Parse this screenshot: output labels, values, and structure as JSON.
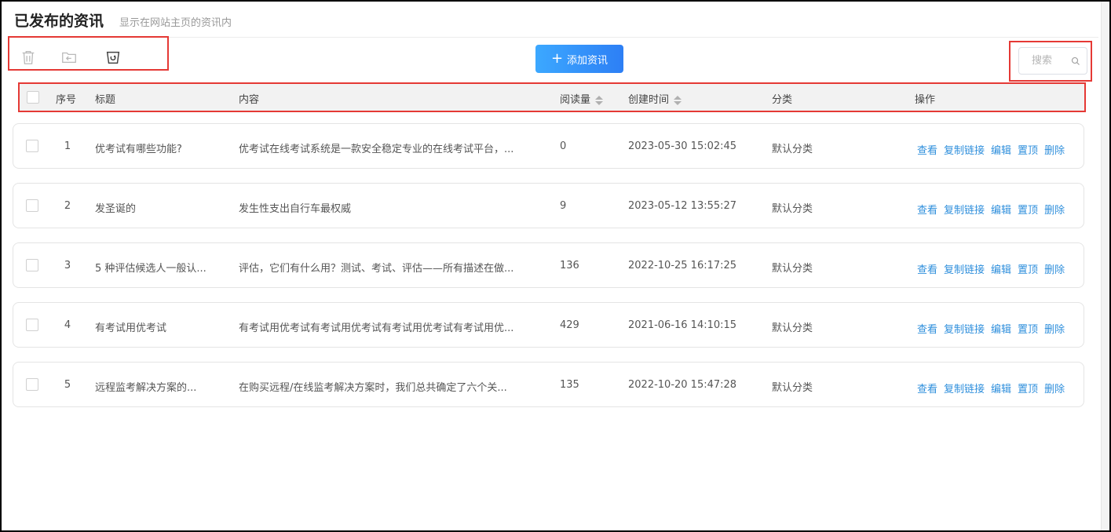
{
  "header": {
    "title": "已发布的资讯",
    "subtitle": "显示在网站主页的资讯内"
  },
  "toolbar": {
    "icons": [
      "trash-icon",
      "folder-back-icon",
      "recycle-bin-icon"
    ],
    "add_label": "添加资讯",
    "add_icon": "plus-icon",
    "search_placeholder": "搜索",
    "search_icon": "search-icon"
  },
  "table": {
    "columns": {
      "index": "序号",
      "title": "标题",
      "content": "内容",
      "reads": "阅读量",
      "created": "创建时间",
      "category": "分类",
      "actions": "操作"
    },
    "action_labels": [
      "查看",
      "复制链接",
      "编辑",
      "置顶",
      "删除"
    ],
    "rows": [
      {
        "index": "1",
        "title": "优考试有哪些功能?",
        "content": "优考试在线考试系统是一款安全稳定专业的在线考试平台，...",
        "reads": "0",
        "created": "2023-05-30 15:02:45",
        "category": "默认分类"
      },
      {
        "index": "2",
        "title": "发圣诞的",
        "content": "发生性支出自行车最权威",
        "reads": "9",
        "created": "2023-05-12 13:55:27",
        "category": "默认分类"
      },
      {
        "index": "3",
        "title": "5 种评估候选人一般认...",
        "content": "评估，它们有什么用？测试、考试、评估——所有描述在做...",
        "reads": "136",
        "created": "2022-10-25 16:17:25",
        "category": "默认分类"
      },
      {
        "index": "4",
        "title": "有考试用优考试",
        "content": "有考试用优考试有考试用优考试有考试用优考试有考试用优...",
        "reads": "429",
        "created": "2021-06-16 14:10:15",
        "category": "默认分类"
      },
      {
        "index": "5",
        "title": "远程监考解决方案的...",
        "content": "在购买远程/在线监考解决方案时，我们总共确定了六个关...",
        "reads": "135",
        "created": "2022-10-20 15:47:28",
        "category": "默认分类"
      }
    ]
  },
  "colors": {
    "accent": "#2d7ff5",
    "link": "#2f8fdc",
    "highlight_box": "#e53935"
  }
}
